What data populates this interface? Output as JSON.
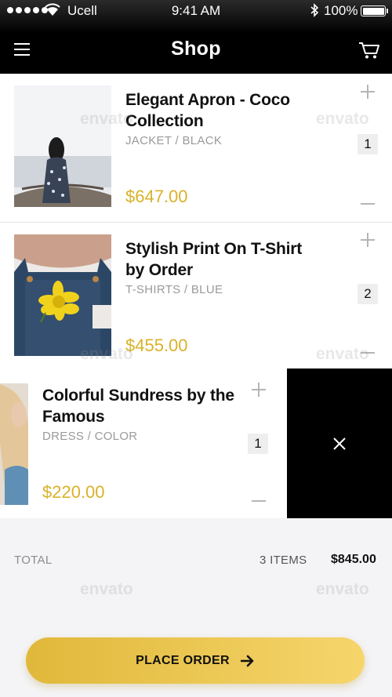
{
  "status_bar": {
    "carrier": "Ucell",
    "time": "9:41 AM",
    "battery_percent": "100%",
    "battery_level": 1.0
  },
  "nav": {
    "title": "Shop",
    "menu_icon": "hamburger-menu-icon",
    "cart_icon": "shopping-cart-icon"
  },
  "cart_items": [
    {
      "name": "Elegant Apron - Coco Collection",
      "category": "JACKET / BLACK",
      "price": "$647.00",
      "quantity": "1"
    },
    {
      "name": "Stylish Print On T-Shirt by Order",
      "category": "T-SHIRTS / BLUE",
      "price": "$455.00",
      "quantity": "2"
    },
    {
      "name": "Colorful Sundress by the Famous",
      "category": "DRESS / COLOR",
      "price": "$220.00",
      "quantity": "1"
    }
  ],
  "swipe_action": {
    "icon": "close-icon"
  },
  "summary": {
    "label": "TOTAL",
    "items_count": "3 ITEMS",
    "amount": "$845.00"
  },
  "order_button": {
    "label": "PLACE ORDER",
    "icon": "arrow-right-icon"
  },
  "watermark": "envato",
  "colors": {
    "accent_gold": "#d9b22a",
    "button_gradient_start": "#e0b83a",
    "button_gradient_end": "#f6d56b",
    "header_bg": "#000000",
    "delete_bg": "#000000"
  }
}
